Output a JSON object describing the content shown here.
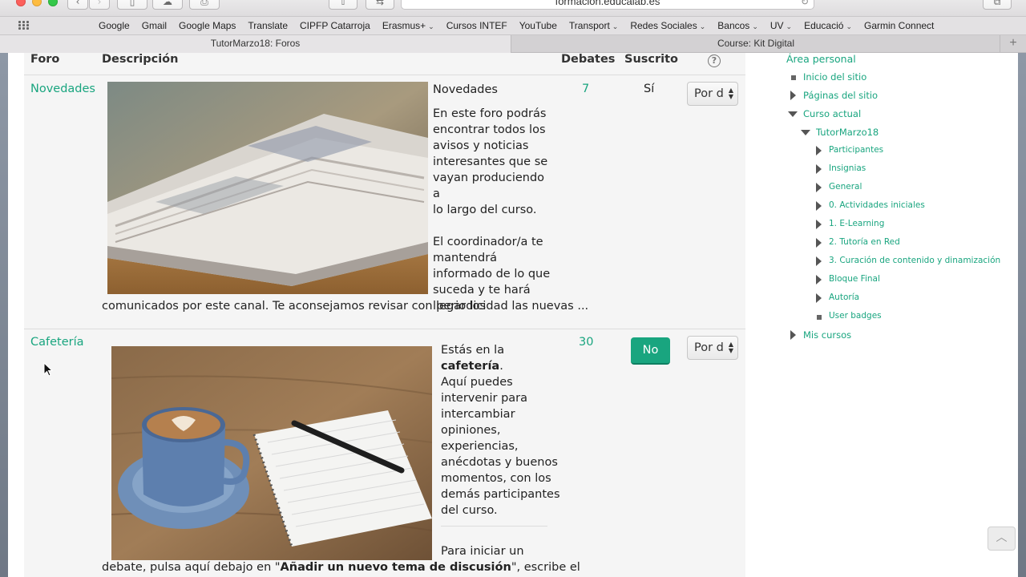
{
  "browser": {
    "url": "formacion.educalab.es",
    "bookmarks": [
      {
        "label": "Google",
        "dropdown": false
      },
      {
        "label": "Gmail",
        "dropdown": false
      },
      {
        "label": "Google Maps",
        "dropdown": false
      },
      {
        "label": "Translate",
        "dropdown": false
      },
      {
        "label": "CIPFP Catarroja",
        "dropdown": false
      },
      {
        "label": "Erasmus+",
        "dropdown": true
      },
      {
        "label": "Cursos INTEF",
        "dropdown": false
      },
      {
        "label": "YouTube",
        "dropdown": false
      },
      {
        "label": "Transport",
        "dropdown": true
      },
      {
        "label": "Redes Sociales",
        "dropdown": true
      },
      {
        "label": "Bancos",
        "dropdown": true
      },
      {
        "label": "UV",
        "dropdown": true
      },
      {
        "label": "Educació",
        "dropdown": true
      },
      {
        "label": "Garmin Connect",
        "dropdown": false
      }
    ],
    "tabs": {
      "active": "TutorMarzo18: Foros",
      "other": "Course: Kit Digital"
    }
  },
  "table": {
    "headers": {
      "forum": "Foro",
      "description": "Descripción",
      "debates": "Debates",
      "subscribed": "Suscrito"
    },
    "rows": [
      {
        "name": "Novedades",
        "debates": "7",
        "subscribed": "Sí",
        "select_value": "Por d",
        "desc_title": "Novedades",
        "desc_lines_a": [
          "En este foro podrás",
          "encontrar todos los",
          "avisos y noticias",
          "interesantes que se",
          "vayan produciendo a",
          "lo largo del curso."
        ],
        "desc_lines_b": [
          "El coordinador/a te",
          "mantendrá",
          "informado de lo que",
          "suceda y te hará",
          "llegar los"
        ],
        "desc_tail": "comunicados por este canal. Te aconsejamos revisar con periodicidad las nuevas ..."
      },
      {
        "name": "Cafetería",
        "debates": "30",
        "subscribe_button": "No",
        "select_value": "Por d",
        "desc_intro": "Estás en la",
        "desc_bold": "cafetería",
        "desc_bold_end": ".",
        "desc_lines": [
          "Aquí puedes",
          "intervenir para",
          "intercambiar",
          "opiniones,",
          "experiencias,",
          "anécdotas y buenos",
          "momentos, con los",
          "demás participantes",
          "del curso."
        ],
        "desc_next": "Para iniciar un",
        "desc_tail_a": "debate, pulsa aquí debajo en \"",
        "desc_tail_bold": "Añadir un nuevo tema de discusión",
        "desc_tail_b": "\", escribe el"
      }
    ]
  },
  "nav": {
    "items": [
      {
        "label": "Área personal",
        "level": 0,
        "marker": "none"
      },
      {
        "label": "Inicio del sitio",
        "level": 1,
        "marker": "square"
      },
      {
        "label": "Páginas del sitio",
        "level": 1,
        "marker": "right"
      },
      {
        "label": "Curso actual",
        "level": 1,
        "marker": "down"
      },
      {
        "label": "TutorMarzo18",
        "level": 2,
        "marker": "down"
      },
      {
        "label": "Participantes",
        "level": 3,
        "marker": "right"
      },
      {
        "label": "Insignias",
        "level": 3,
        "marker": "right"
      },
      {
        "label": "General",
        "level": 3,
        "marker": "right"
      },
      {
        "label": "0. Actividades iniciales",
        "level": 3,
        "marker": "right"
      },
      {
        "label": "1. E-Learning",
        "level": 3,
        "marker": "right"
      },
      {
        "label": "2. Tutoría en Red",
        "level": 3,
        "marker": "right"
      },
      {
        "label": "3. Curación de contenido y dinamización",
        "level": 3,
        "marker": "right"
      },
      {
        "label": "Bloque Final",
        "level": 3,
        "marker": "right"
      },
      {
        "label": "Autoría",
        "level": 3,
        "marker": "right"
      },
      {
        "label": "User badges",
        "level": 3,
        "marker": "square"
      },
      {
        "label": "Mis cursos",
        "level": 1,
        "marker": "right"
      }
    ]
  },
  "icons": {
    "help": "question-circle-icon",
    "scroll_top": "chevron-up-icon"
  },
  "colors": {
    "accent": "#19a57f",
    "table_bg": "#f5f5f5"
  }
}
